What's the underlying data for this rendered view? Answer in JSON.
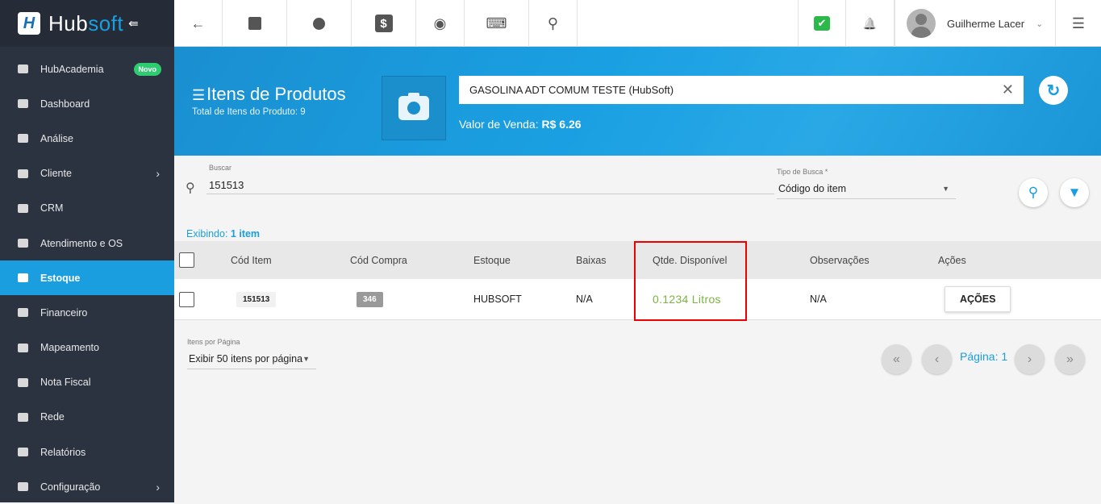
{
  "brand": {
    "logo_letter": "H",
    "name_a": "Hub",
    "name_b": "soft",
    "collapse_glyph": "⇚"
  },
  "sidebar": {
    "items": [
      {
        "label": "HubAcademia",
        "badge": "Novo"
      },
      {
        "label": "Dashboard"
      },
      {
        "label": "Análise"
      },
      {
        "label": "Cliente",
        "chevron": "›"
      },
      {
        "label": "CRM"
      },
      {
        "label": "Atendimento e OS"
      },
      {
        "label": "Estoque"
      },
      {
        "label": "Financeiro"
      },
      {
        "label": "Mapeamento"
      },
      {
        "label": "Nota Fiscal"
      },
      {
        "label": "Rede"
      },
      {
        "label": "Relatórios"
      },
      {
        "label": "Configuração",
        "chevron": "›"
      }
    ]
  },
  "topbar": {
    "back_glyph": "←",
    "dollar_glyph": "$",
    "eye_glyph": "◉",
    "terminal_glyph": "⌨",
    "search_glyph": "⚲",
    "check_glyph": "✔",
    "bell_glyph": "🔔",
    "user_name": "Guilherme Lacer",
    "dropdown_glyph": "⌄",
    "menu_glyph": "☰"
  },
  "banner": {
    "title_icon": "☰",
    "title": "Itens de Produtos",
    "subtitle": "Total de Itens do Produto: 9",
    "product": "GASOLINA ADT COMUM TESTE (HubSoft)",
    "clear_glyph": "✕",
    "price_label": "Valor de Venda:",
    "price_value": "R$ 6.26",
    "refresh_glyph": "↻"
  },
  "search": {
    "icon_glyph": "⚲",
    "label": "Buscar",
    "value": "151513",
    "type_label": "Tipo de Busca *",
    "type_value": "Código do item",
    "caret": "▼",
    "search_btn_glyph": "⚲",
    "filter_btn_glyph": "▼",
    "showing_prefix": "Exibindo:",
    "showing_count": "1 item"
  },
  "table": {
    "headers": [
      "Cód Item",
      "Cód Compra",
      "Estoque",
      "Baixas",
      "Qtde. Disponível",
      "Observações",
      "Ações"
    ],
    "rows": [
      {
        "cod_item": "151513",
        "cod_compra": "346",
        "estoque": "HUBSOFT",
        "baixas": "N/A",
        "qtde": "0.1234 Litros",
        "obs": "N/A",
        "acoes": "AÇÕES"
      }
    ]
  },
  "pagination": {
    "per_page_label": "Itens por Página",
    "per_page_value": "Exibir 50 itens por página",
    "caret": "▼",
    "first": "«",
    "prev": "‹",
    "page_text": "Página: 1",
    "next": "›",
    "last": "»"
  },
  "colors": {
    "accent": "#1a9ee0",
    "sidebar": "#2c3340",
    "qty_green": "#7cb342",
    "highlight": "#ee0000"
  }
}
